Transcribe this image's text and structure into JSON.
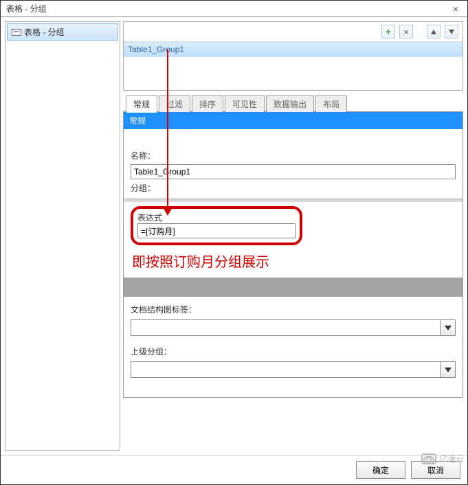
{
  "window": {
    "title": "表格 - 分组",
    "close": "×"
  },
  "tree": {
    "item0": "表格 - 分组"
  },
  "groups": {
    "add": "+",
    "del": "×",
    "row0": "Table1_Group1"
  },
  "tabs": {
    "t0": "常规",
    "t1": "过滤",
    "t2": "排序",
    "t3": "可见性",
    "t4": "数据输出",
    "t5": "布局"
  },
  "panel": {
    "hdr": "常规",
    "name_lbl": "名称：",
    "name_val": "Table1_Group1",
    "group_lbl": "分组：",
    "expr_lbl": "表达式",
    "expr_val": "=[订购月]",
    "doc_lbl": "文档结构图标签：",
    "doc_val": "",
    "parent_lbl": "上级分组：",
    "parent_val": ""
  },
  "annot": {
    "text": "即按照订购月分组展示"
  },
  "footer": {
    "ok": "确定",
    "cancel": "取消"
  },
  "watermark": {
    "text": "亿速云"
  }
}
